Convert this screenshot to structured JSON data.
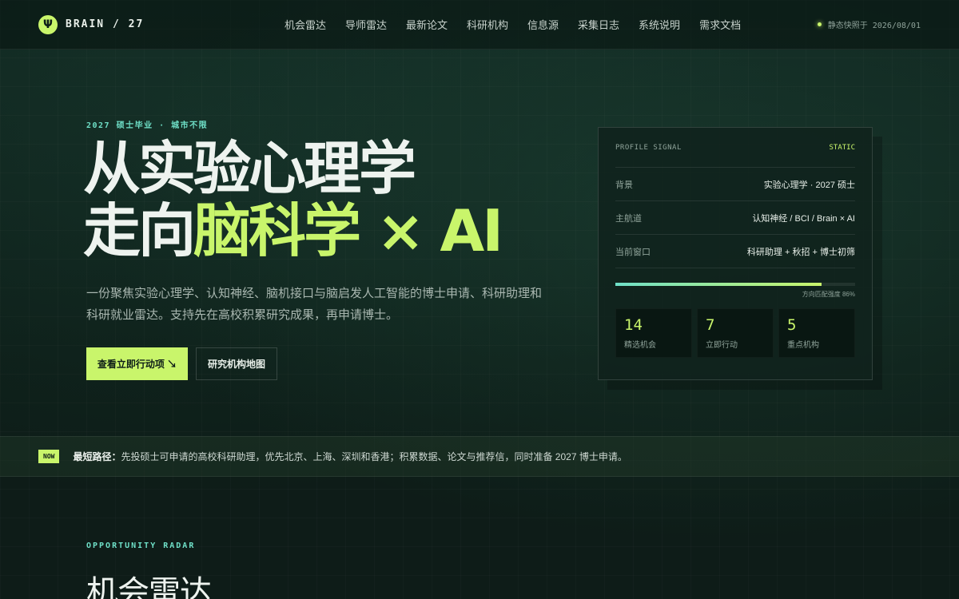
{
  "header": {
    "logo_glyph": "Ψ",
    "brand": "BRAIN / 27",
    "nav": [
      "机会雷达",
      "导师雷达",
      "最新论文",
      "科研机构",
      "信息源",
      "采集日志",
      "系统说明",
      "需求文档"
    ],
    "snapshot": "静态快照于 2026/08/01"
  },
  "hero": {
    "eyebrow": "2027 硕士毕业 · 城市不限",
    "title_line1": "从实验心理学",
    "title_line2_plain": "走向",
    "title_line2_accent": "脑科学 × AI",
    "lead": "一份聚焦实验心理学、认知神经、脑机接口与脑启发人工智能的博士申请、科研助理和科研就业雷达。支持先在高校积累研究成果，再申请博士。",
    "primary_button": "查看立即行动项 ↘",
    "secondary_button": "研究机构地图"
  },
  "profile_card": {
    "label": "PROFILE SIGNAL",
    "status": "STATIC",
    "rows": [
      {
        "key": "背景",
        "value": "实验心理学 · 2027 硕士"
      },
      {
        "key": "主航道",
        "value": "认知神经 / BCI / Brain × AI"
      },
      {
        "key": "当前窗口",
        "value": "科研助理 + 秋招 + 博士初筛"
      }
    ],
    "match_label": "方向匹配强度",
    "match_value": "86%",
    "match_fraction": 0.86,
    "stats": [
      {
        "value": "14",
        "label": "精选机会"
      },
      {
        "value": "7",
        "label": "立即行动"
      },
      {
        "value": "5",
        "label": "重点机构"
      }
    ]
  },
  "strip": {
    "badge": "NOW",
    "title": "最短路径：",
    "text": "先投硕士可申请的高校科研助理，优先北京、上海、深圳和香港；积累数据、论文与推荐信，同时准备 2027 博士申请。"
  },
  "section": {
    "eyebrow": "OPPORTUNITY RADAR",
    "title": "机会雷达"
  },
  "colors": {
    "accent": "#c9f56b",
    "teal": "#6fe0c8",
    "background": "#0f1f1a"
  }
}
